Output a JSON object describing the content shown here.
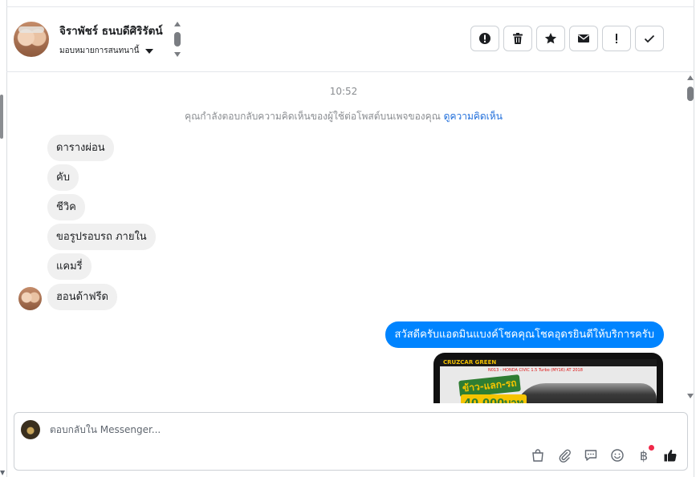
{
  "header": {
    "contact_name": "จิราพัชร์ ธนบดีศิริรัตน์",
    "assign_label": "มอบหมายการสนทนานี้",
    "actions": [
      {
        "icon": "alert-circle-icon",
        "label": "Mark as spam"
      },
      {
        "icon": "trash-icon",
        "label": "Delete"
      },
      {
        "icon": "star-icon",
        "label": "Star"
      },
      {
        "icon": "envelope-icon",
        "label": "Mark as unread"
      },
      {
        "icon": "exclamation-icon",
        "label": "Follow up"
      },
      {
        "icon": "checkmark-icon",
        "label": "Mark as done"
      }
    ]
  },
  "thread": {
    "timestamp": "10:52",
    "notice_text": "คุณกำลังตอบกลับความคิดเห็นของผู้ใช้ต่อโพสต์บนเพจของคุณ",
    "notice_link": "ดูความคิดเห็น",
    "incoming": [
      "ดารางผ่อน",
      "คับ",
      "ชีวิค",
      "ขอรูปรอบรถ ภายใน",
      "แคมรี่",
      "ฮอนด้าฟรีด"
    ],
    "outgoing": "สวัสดีครับแอดมินแบงค์โชคคุณโชคอุดรยินดีให้บริการครับ",
    "image": {
      "strip_text": "CRUZCAR GREEN",
      "sub_text": "N013 - HONDA CIVIC 1.5 Turbo (MY16) AT 2018",
      "promo_text": "ข้าว-แลก-รถ",
      "amount_text": "40,000บาท"
    }
  },
  "composer": {
    "placeholder": "ตอบกลับใน Messenger...",
    "tools": [
      "shopping-bag-icon",
      "paperclip-icon",
      "saved-reply-icon",
      "emoji-icon",
      "baht-payment-icon",
      "thumbs-up-icon"
    ]
  },
  "colors": {
    "accent": "#0084ff",
    "bubble_in": "#f0f0f0",
    "link": "#216fdb",
    "notification_dot": "#f02849"
  }
}
